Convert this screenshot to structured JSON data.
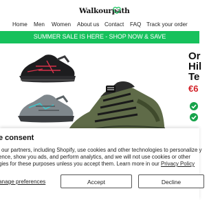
{
  "header": {
    "logo_text": "Walkourpath",
    "logo_icon": "heart-outline-icon",
    "nav": [
      "Home",
      "Men",
      "Women",
      "About us",
      "Contact",
      "FAQ",
      "Track your order"
    ]
  },
  "banner": {
    "text": "SUMMER SALE IS HERE - SHOP NOW & SAVE",
    "color": "#16c15c"
  },
  "product": {
    "title_visible": "Or\nHil\nTe",
    "price_visible": "€6",
    "price_color": "#d21f26",
    "feature_icons": [
      "check-circle-icon",
      "check-circle-icon"
    ],
    "images": [
      "black-hiking-shoe-thumbnail",
      "grey-hiking-shoe-thumbnail",
      "olive-hiking-shoe-main-image"
    ]
  },
  "consent": {
    "title": "e consent",
    "body_lines": [
      "l our partners, including Shopify, use cookies and other technologies to personalize y",
      "ence, show you ads, and perform analytics, and we will not use cookies or other",
      "gies for these purposes unless you accept them. Learn more in our "
    ],
    "privacy_link": "Privacy Policy",
    "manage_link": "anage preferences",
    "accept_label": "Accept",
    "decline_label": "Decline"
  }
}
